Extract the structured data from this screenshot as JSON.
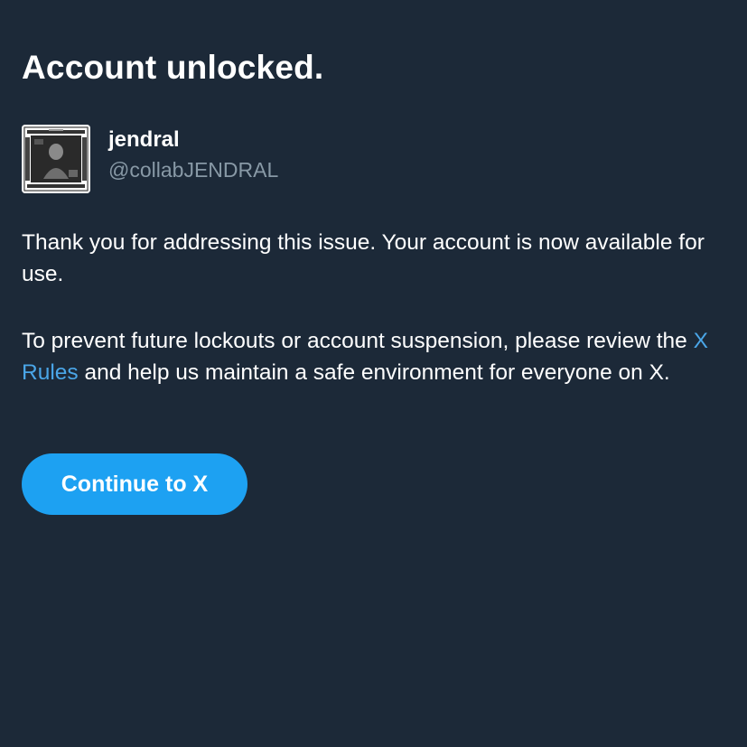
{
  "dialog": {
    "title": "Account unlocked."
  },
  "account": {
    "display_name": "jendral",
    "handle": "@collabJENDRAL",
    "avatar_icon": "profile-photo-avatar"
  },
  "message": {
    "paragraph1": "Thank you for addressing this issue. Your account is now available for use.",
    "paragraph2_before": "To prevent future lockouts or account suspension, please review the ",
    "paragraph2_link": "X Rules",
    "paragraph2_after": " and help us maintain a safe environment for everyone on X."
  },
  "actions": {
    "continue_label": "Continue to X"
  },
  "colors": {
    "background": "#1c2938",
    "accent": "#1da1f2",
    "link": "#4aa6e8",
    "secondary_text": "#8899a6"
  }
}
